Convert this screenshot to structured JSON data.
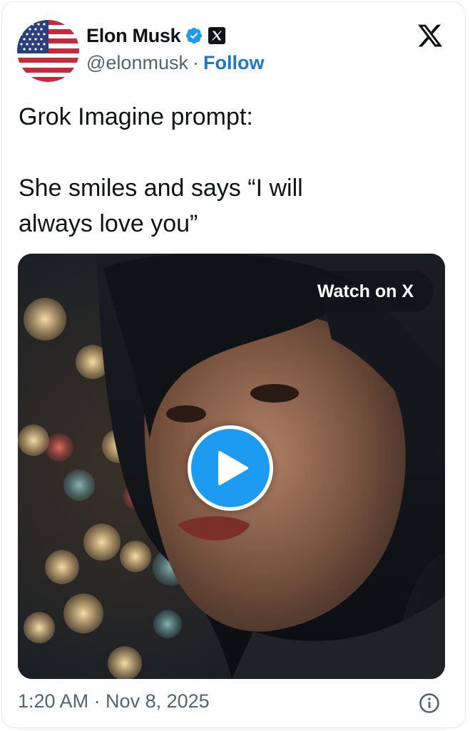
{
  "author": {
    "display_name": "Elon Musk",
    "handle": "@elonmusk",
    "separator": "·",
    "follow_label": "Follow",
    "verified_badge": "verified-badge-icon",
    "affiliation_badge": "x-affiliate-icon"
  },
  "header": {
    "brand_icon": "x-logo-icon"
  },
  "tweet": {
    "text": "Grok Imagine prompt:\n\nShe smiles and says “I will\nalways love you”"
  },
  "media": {
    "watch_label": "Watch on X",
    "play_icon": "play-icon",
    "description_icon": "video-thumbnail"
  },
  "footer": {
    "timestamp": "1:20 AM · Nov 8, 2025",
    "info_icon": "info-icon"
  },
  "colors": {
    "accent": "#1d9bf0",
    "follow": "#1d77c9",
    "secondary_text": "#536471",
    "verified": "#1d9bf0"
  }
}
